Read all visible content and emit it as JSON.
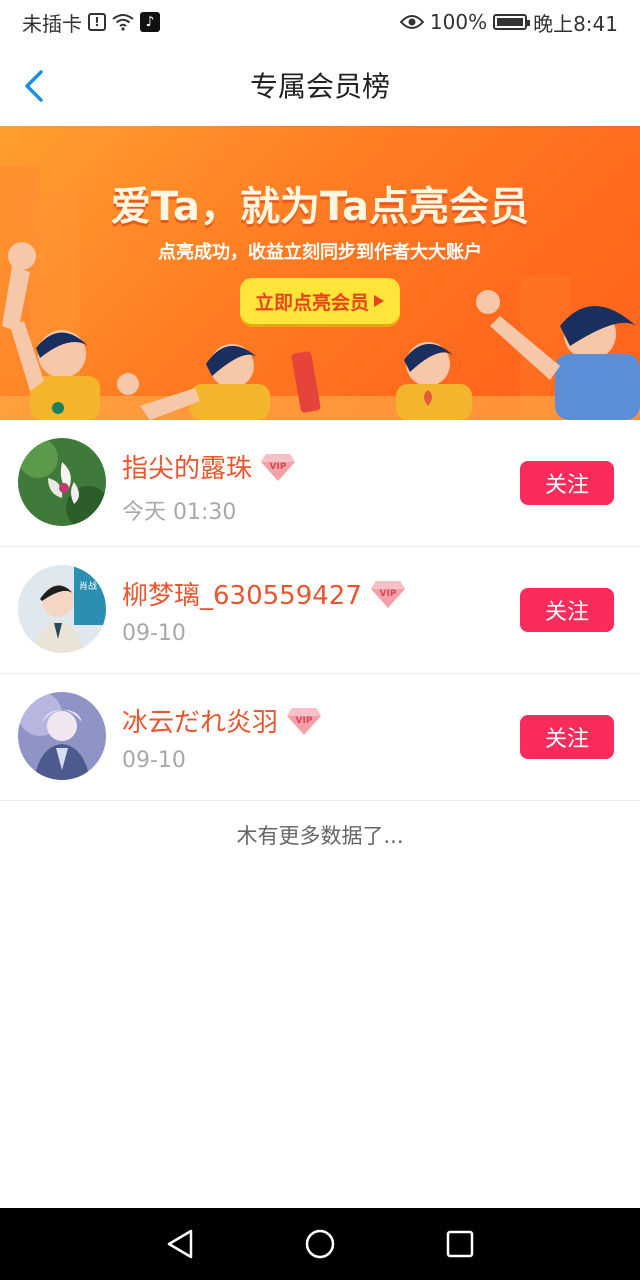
{
  "status_bar": {
    "carrier": "未插卡",
    "battery_percent": "100%",
    "time": "晚上8:41"
  },
  "header": {
    "title": "专属会员榜"
  },
  "banner": {
    "headline": "爱Ta，就为Ta点亮会员",
    "subtitle": "点亮成功，收益立刻同步到作者大大账户",
    "cta_label": "立即点亮会员"
  },
  "members": [
    {
      "name": "指尖的露珠",
      "time": "今天 01:30",
      "badge": "VIP",
      "follow_label": "关注"
    },
    {
      "name": "柳梦璃_630559427",
      "time": "09-10",
      "badge": "VIP",
      "follow_label": "关注"
    },
    {
      "name": "冰云だれ炎羽",
      "time": "09-10",
      "badge": "VIP",
      "follow_label": "关注"
    }
  ],
  "footer_text": "木有更多数据了...",
  "colors": {
    "accent": "#fb2c5b",
    "name": "#e8552f",
    "banner": "#ff7a22",
    "back_arrow": "#1a8fe8"
  },
  "icons": {
    "back": "chevron-left-icon",
    "vip": "vip-diamond-icon",
    "nav_back": "triangle-back-icon",
    "nav_home": "circle-home-icon",
    "nav_recent": "square-recent-icon"
  }
}
